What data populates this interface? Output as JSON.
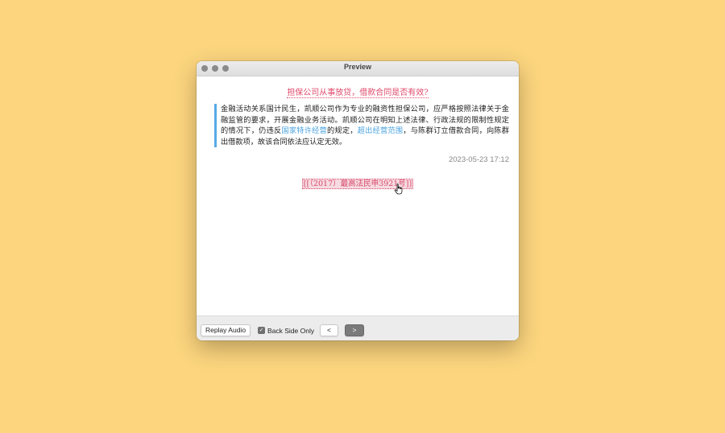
{
  "window": {
    "title": "Preview"
  },
  "card": {
    "question": "担保公司从事放贷，借款合同是否有效?",
    "answer_parts": [
      "金融活动关系国计民生，凯顺公司作为专业的融资性担保公司，应严格按照法律关于金融监管的要求，开展金融业务活动。凯顺公司在明知上述法律、行政法规的限制性规定的情况下，仍违反",
      "国家特许经营",
      "的规定，",
      "超出经营范围",
      "，与陈群订立借款合同，向陈群出借款项，故该合同依法应认定无效。"
    ],
    "timestamp": "2023-05-23 17:12",
    "reference": "[[（2017）最高法民申3921号]]"
  },
  "toolbar": {
    "replay_label": "Replay Audio",
    "back_side_label": "Back Side Only",
    "back_side_checked": true,
    "prev_label": "<",
    "next_label": ">"
  },
  "colors": {
    "background": "#FCD57E",
    "question": "#e0486a",
    "highlight": "#4aa3e0",
    "quote_bar": "#56a9e6"
  },
  "icons": {
    "cursor": "hand-pointer-icon",
    "check": "checkmark-icon"
  }
}
